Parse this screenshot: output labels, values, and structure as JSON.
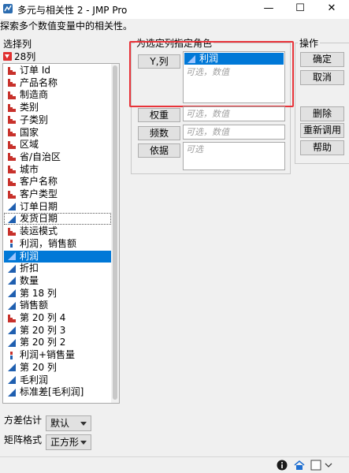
{
  "window": {
    "title": "多元与相关性 2 - JMP Pro",
    "minimize": "—",
    "maximize": "☐",
    "close": "✕"
  },
  "hint": "探索多个数值变量中的相关性。",
  "columns_panel": {
    "label": "选择列",
    "count": "28列",
    "items": [
      {
        "label": "订单 Id",
        "type": "nominal"
      },
      {
        "label": "产品名称",
        "type": "nominal"
      },
      {
        "label": "制造商",
        "type": "nominal"
      },
      {
        "label": "类别",
        "type": "nominal"
      },
      {
        "label": "子类别",
        "type": "nominal"
      },
      {
        "label": "国家",
        "type": "nominal"
      },
      {
        "label": "区域",
        "type": "nominal"
      },
      {
        "label": "省/自治区",
        "type": "nominal"
      },
      {
        "label": "城市",
        "type": "nominal"
      },
      {
        "label": "客户名称",
        "type": "nominal"
      },
      {
        "label": "客户类型",
        "type": "nominal"
      },
      {
        "label": "订单日期",
        "type": "continuous"
      },
      {
        "label": "发货日期",
        "type": "continuous"
      },
      {
        "label": "装运模式",
        "type": "nominal"
      },
      {
        "label": "利润，销售额",
        "type": "multiple"
      },
      {
        "label": "利润",
        "type": "continuous"
      },
      {
        "label": "折扣",
        "type": "continuous"
      },
      {
        "label": "数量",
        "type": "continuous"
      },
      {
        "label": "第 18 列",
        "type": "continuous"
      },
      {
        "label": "销售额",
        "type": "continuous"
      },
      {
        "label": "第 20 列 4",
        "type": "nominal"
      },
      {
        "label": "第 20 列 3",
        "type": "continuous"
      },
      {
        "label": "第 20 列 2",
        "type": "continuous"
      },
      {
        "label": "利润+销售量",
        "type": "multiple"
      },
      {
        "label": "第 20 列",
        "type": "continuous"
      },
      {
        "label": "毛利润",
        "type": "continuous"
      },
      {
        "label": "标准差[毛利润]",
        "type": "continuous"
      }
    ]
  },
  "roles_panel": {
    "label": "为选定列指定角色",
    "roles": [
      {
        "button": "Y,列",
        "value": "利润",
        "placeholder": "可选，数值"
      },
      {
        "button": "权重",
        "value": "",
        "placeholder": "可选，数值"
      },
      {
        "button": "频数",
        "value": "",
        "placeholder": "可选，数值"
      },
      {
        "button": "依据",
        "value": "",
        "placeholder": "可选"
      }
    ]
  },
  "actions_panel": {
    "label": "操作",
    "ok": "确定",
    "cancel": "取消",
    "remove": "删除",
    "recall": "重新调用",
    "help": "帮助"
  },
  "options": {
    "variance_label": "方差估计",
    "variance_value": "默认",
    "matrix_label": "矩阵格式",
    "matrix_value": "正方形"
  },
  "colors": {
    "selection": "#0078d7",
    "highlight_border": "#e8343a",
    "nominal": "#c8312b",
    "continuous": "#1f5fb0"
  }
}
